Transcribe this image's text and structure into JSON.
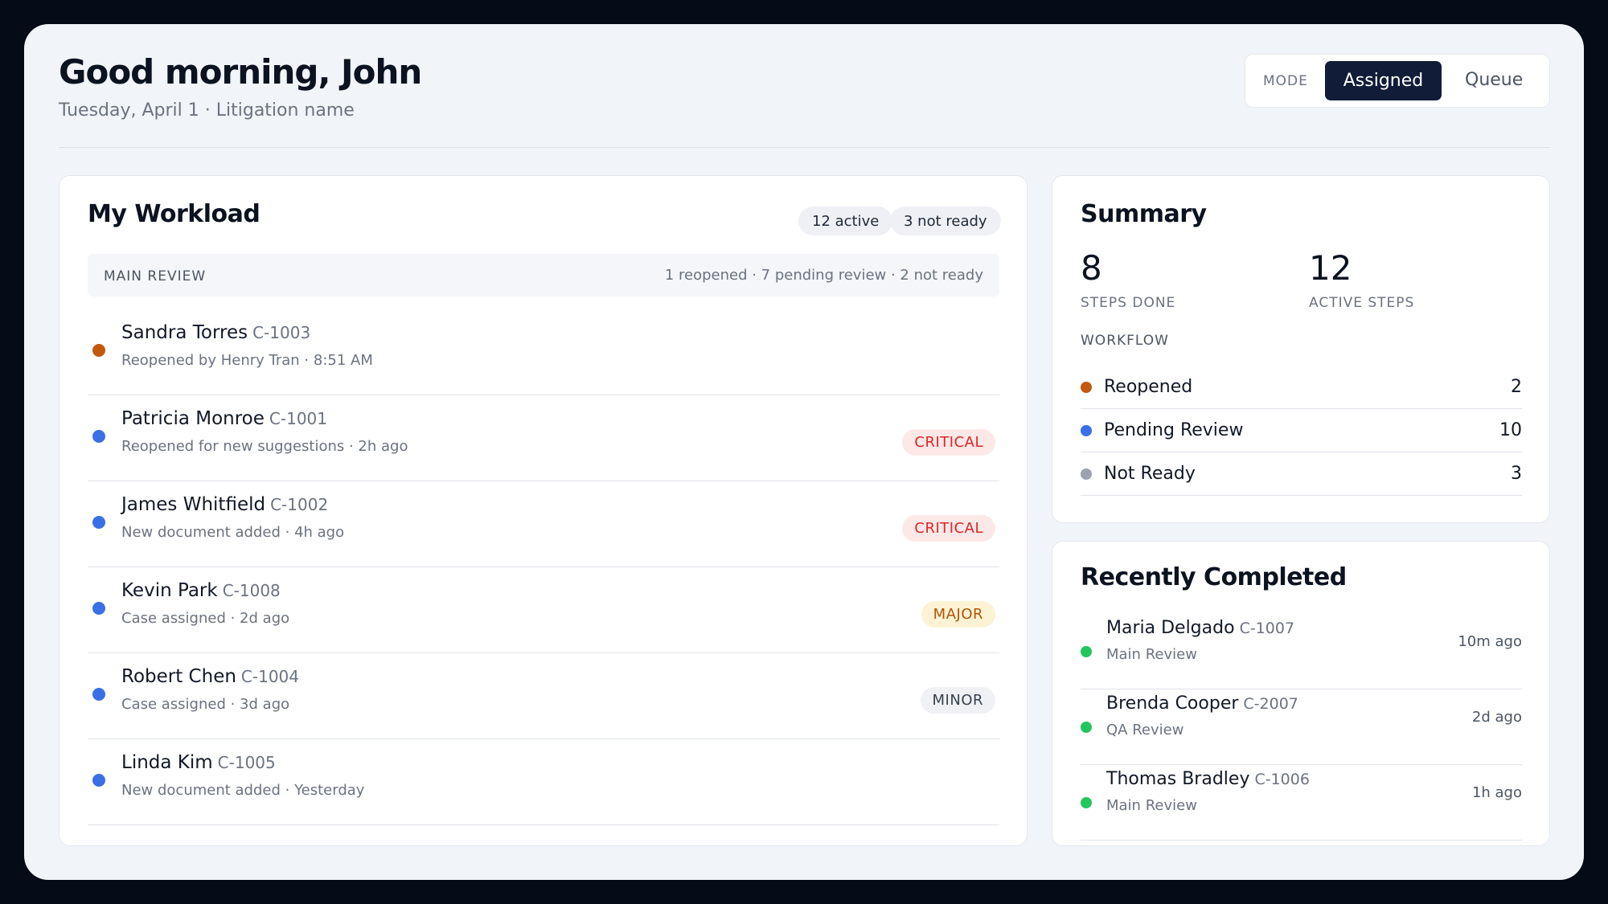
{
  "header": {
    "greeting": "Good morning, John",
    "subline": "Tuesday, April 1 · Litigation name",
    "mode": {
      "label": "MODE",
      "options": [
        "Assigned",
        "Queue"
      ],
      "selected": "Assigned"
    }
  },
  "workload": {
    "title": "My Workload",
    "chips": [
      "12 active",
      "3 not ready"
    ],
    "group": {
      "name": "MAIN REVIEW",
      "stats": "1 reopened · 7 pending review · 2 not ready"
    },
    "items": [
      {
        "name": "Sandra Torres",
        "id": "C-1003",
        "sub": "Reopened by Henry Tran · 8:51 AM",
        "status": "reopened",
        "badge": ""
      },
      {
        "name": "Patricia Monroe",
        "id": "C-1001",
        "sub": "Reopened for new suggestions · 2h ago",
        "status": "pending",
        "badge": "CRITICAL"
      },
      {
        "name": "James Whitfield",
        "id": "C-1002",
        "sub": "New document added · 4h ago",
        "status": "pending",
        "badge": "CRITICAL"
      },
      {
        "name": "Kevin Park",
        "id": "C-1008",
        "sub": "Case assigned · 2d ago",
        "status": "pending",
        "badge": "MAJOR"
      },
      {
        "name": "Robert Chen",
        "id": "C-1004",
        "sub": "Case assigned · 3d ago",
        "status": "pending",
        "badge": "MINOR"
      },
      {
        "name": "Linda Kim",
        "id": "C-1005",
        "sub": "New document added · Yesterday",
        "status": "pending",
        "badge": ""
      }
    ]
  },
  "summary": {
    "title": "Summary",
    "stats": [
      {
        "value": "8",
        "label": "STEPS DONE"
      },
      {
        "value": "12",
        "label": "ACTIVE STEPS"
      }
    ],
    "workflow_label": "WORKFLOW",
    "workflow": [
      {
        "name": "Reopened",
        "count": "2",
        "status": "reopened"
      },
      {
        "name": "Pending Review",
        "count": "10",
        "status": "pending"
      },
      {
        "name": "Not Ready",
        "count": "3",
        "status": "notready"
      }
    ]
  },
  "recent": {
    "title": "Recently Completed",
    "items": [
      {
        "name": "Maria Delgado",
        "id": "C-1007",
        "sub": "Main Review",
        "time": "10m ago"
      },
      {
        "name": "Brenda Cooper",
        "id": "C-2007",
        "sub": "QA Review",
        "time": "2d ago"
      },
      {
        "name": "Thomas Bradley",
        "id": "C-1006",
        "sub": "Main Review",
        "time": "1h ago"
      }
    ]
  },
  "colors": {
    "reopened": "#c2570f",
    "pending": "#3b6fe6",
    "notready": "#9ca3af",
    "completed": "#22c55e",
    "primary_dark": "#101c38"
  }
}
